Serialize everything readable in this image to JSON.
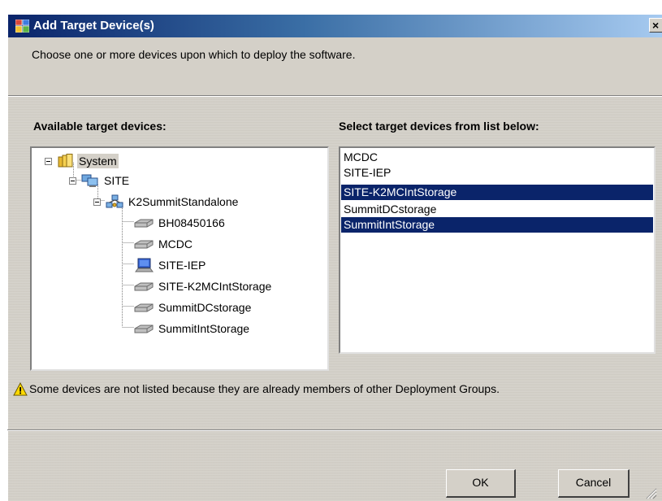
{
  "window": {
    "title": "Add Target Device(s)",
    "close_glyph": "×"
  },
  "instruction": "Choose one or more devices upon which to deploy the software.",
  "available": {
    "heading": "Available target devices:",
    "tree": [
      {
        "label": "System",
        "icon": "folder-icon",
        "level": 0,
        "expanded": true,
        "selected": true
      },
      {
        "label": "SITE",
        "icon": "site-computers-icon",
        "level": 1,
        "expanded": true
      },
      {
        "label": "K2SummitStandalone",
        "icon": "network-group-icon",
        "level": 2,
        "expanded": true
      },
      {
        "label": "BH08450166",
        "icon": "drive-icon",
        "level": 3
      },
      {
        "label": "MCDC",
        "icon": "drive-icon",
        "level": 3
      },
      {
        "label": "SITE-IEP",
        "icon": "computer-icon",
        "level": 3
      },
      {
        "label": "SITE-K2MCIntStorage",
        "icon": "drive-icon",
        "level": 3
      },
      {
        "label": "SummitDCstorage",
        "icon": "drive-icon",
        "level": 3
      },
      {
        "label": "SummitIntStorage",
        "icon": "drive-icon",
        "level": 3
      }
    ]
  },
  "selection": {
    "heading": "Select target devices from list below:",
    "items": [
      {
        "label": "MCDC",
        "selected": false
      },
      {
        "label": "SITE-IEP",
        "selected": false
      },
      {
        "label": "SITE-K2MCIntStorage",
        "selected": true
      },
      {
        "label": "SummitDCstorage",
        "selected": false
      },
      {
        "label": "SummitIntStorage",
        "selected": true
      }
    ]
  },
  "note": {
    "icon": "warning-icon",
    "text": "Some devices are not listed because they are already members of other Deployment Groups."
  },
  "buttons": {
    "ok": "OK",
    "cancel": "Cancel"
  },
  "colors": {
    "title_bar_start": "#0a246a",
    "title_bar_end": "#a6caf0",
    "dialog_face": "#d4d0c8",
    "selection_highlight": "#0a246a",
    "warning_yellow": "#ffd800"
  }
}
